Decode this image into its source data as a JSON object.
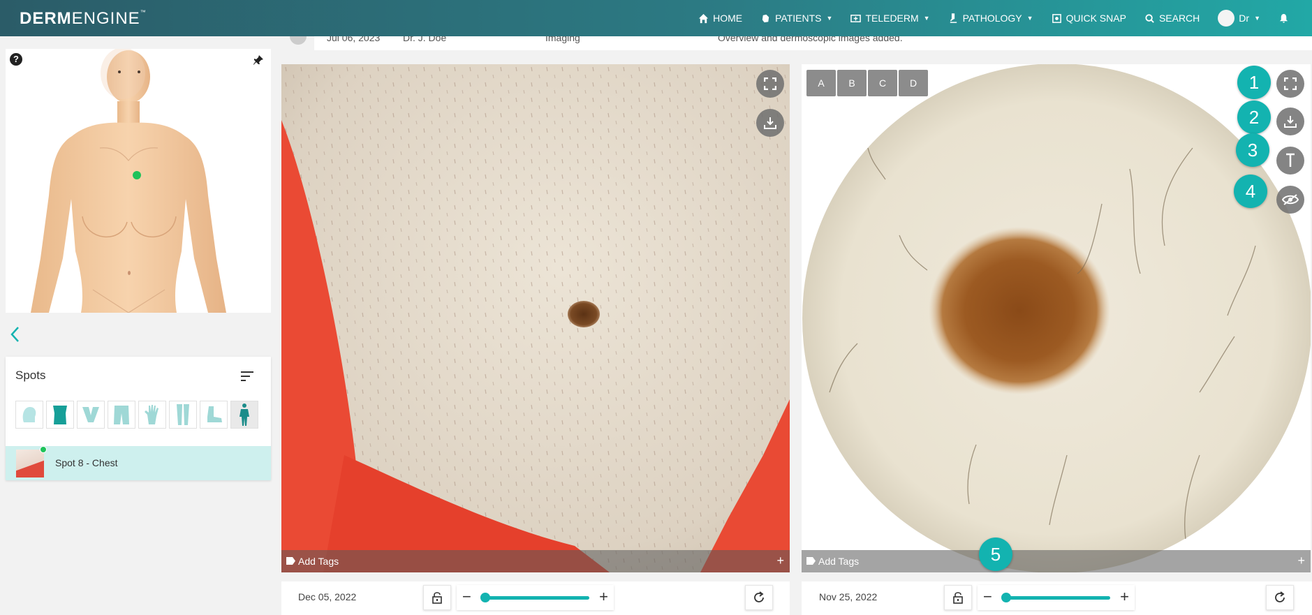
{
  "app": {
    "logo_bold": "DERM",
    "logo_light": "ENGINE",
    "logo_tm": "™"
  },
  "nav": {
    "home": "HOME",
    "patients": "PATIENTS",
    "telederm": "TELEDERM",
    "pathology": "PATHOLOGY",
    "quick_snap": "QUICK SNAP",
    "search": "SEARCH",
    "user": "Dr"
  },
  "history_row": {
    "date": "Jul 06, 2023",
    "doctor": "Dr. J. Doe",
    "type": "Imaging",
    "note": "Overview and dermoscopic images added."
  },
  "spots": {
    "title": "Spots",
    "regions": [
      "head-icon",
      "torso-icon",
      "pelvis-icon",
      "shorts-icon",
      "hand-icon",
      "legs-icon",
      "foot-icon",
      "full-body-icon"
    ],
    "items": [
      {
        "label": "Spot 8 - Chest"
      }
    ]
  },
  "overview": {
    "tags_label": "Add Tags",
    "date": "Dec 05, 2022",
    "zoom_level": 0
  },
  "dermoscopy": {
    "tools": [
      "A",
      "B",
      "C",
      "D"
    ],
    "tags_label": "Add Tags",
    "date": "Nov 25, 2022",
    "zoom_level": 0
  },
  "badges": [
    "1",
    "2",
    "3",
    "4",
    "5"
  ],
  "colors": {
    "accent": "#13b3b0",
    "marker": "#1ec25a",
    "nav_start": "#2b5c68",
    "nav_end": "#22a8a6"
  }
}
